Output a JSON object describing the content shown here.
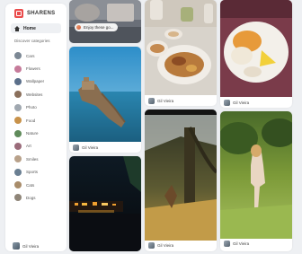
{
  "brand": {
    "name": "SHARENS"
  },
  "nav": {
    "home_label": "Home"
  },
  "categories": {
    "heading": "Discover categories",
    "items": [
      {
        "label": "Cars",
        "color": "#7c8894"
      },
      {
        "label": "Flowers",
        "color": "#c67b9a"
      },
      {
        "label": "Wallpaper",
        "color": "#5b6f8a"
      },
      {
        "label": "Websites",
        "color": "#8a6f5b"
      },
      {
        "label": "Photo",
        "color": "#a0a8b0"
      },
      {
        "label": "Food",
        "color": "#c8924a"
      },
      {
        "label": "Nature",
        "color": "#5f8a5a"
      },
      {
        "label": "Art",
        "color": "#9a6b7a"
      },
      {
        "label": "Smiles",
        "color": "#b8a18a"
      },
      {
        "label": "Sports",
        "color": "#6a7f92"
      },
      {
        "label": "Cats",
        "color": "#a88c6a"
      },
      {
        "label": "Dogs",
        "color": "#8f8578"
      }
    ]
  },
  "current_user": {
    "name": "Gil Vieira"
  },
  "feed": {
    "search_chip": "Enjoy these go...",
    "cards": [
      {
        "author": "Gil Vieira"
      },
      {
        "author": "Gil Vieira"
      },
      {
        "author": "Gil Vieira"
      },
      {
        "author": "Gil Vieira"
      },
      {
        "author": "Gil Vieira"
      }
    ]
  }
}
